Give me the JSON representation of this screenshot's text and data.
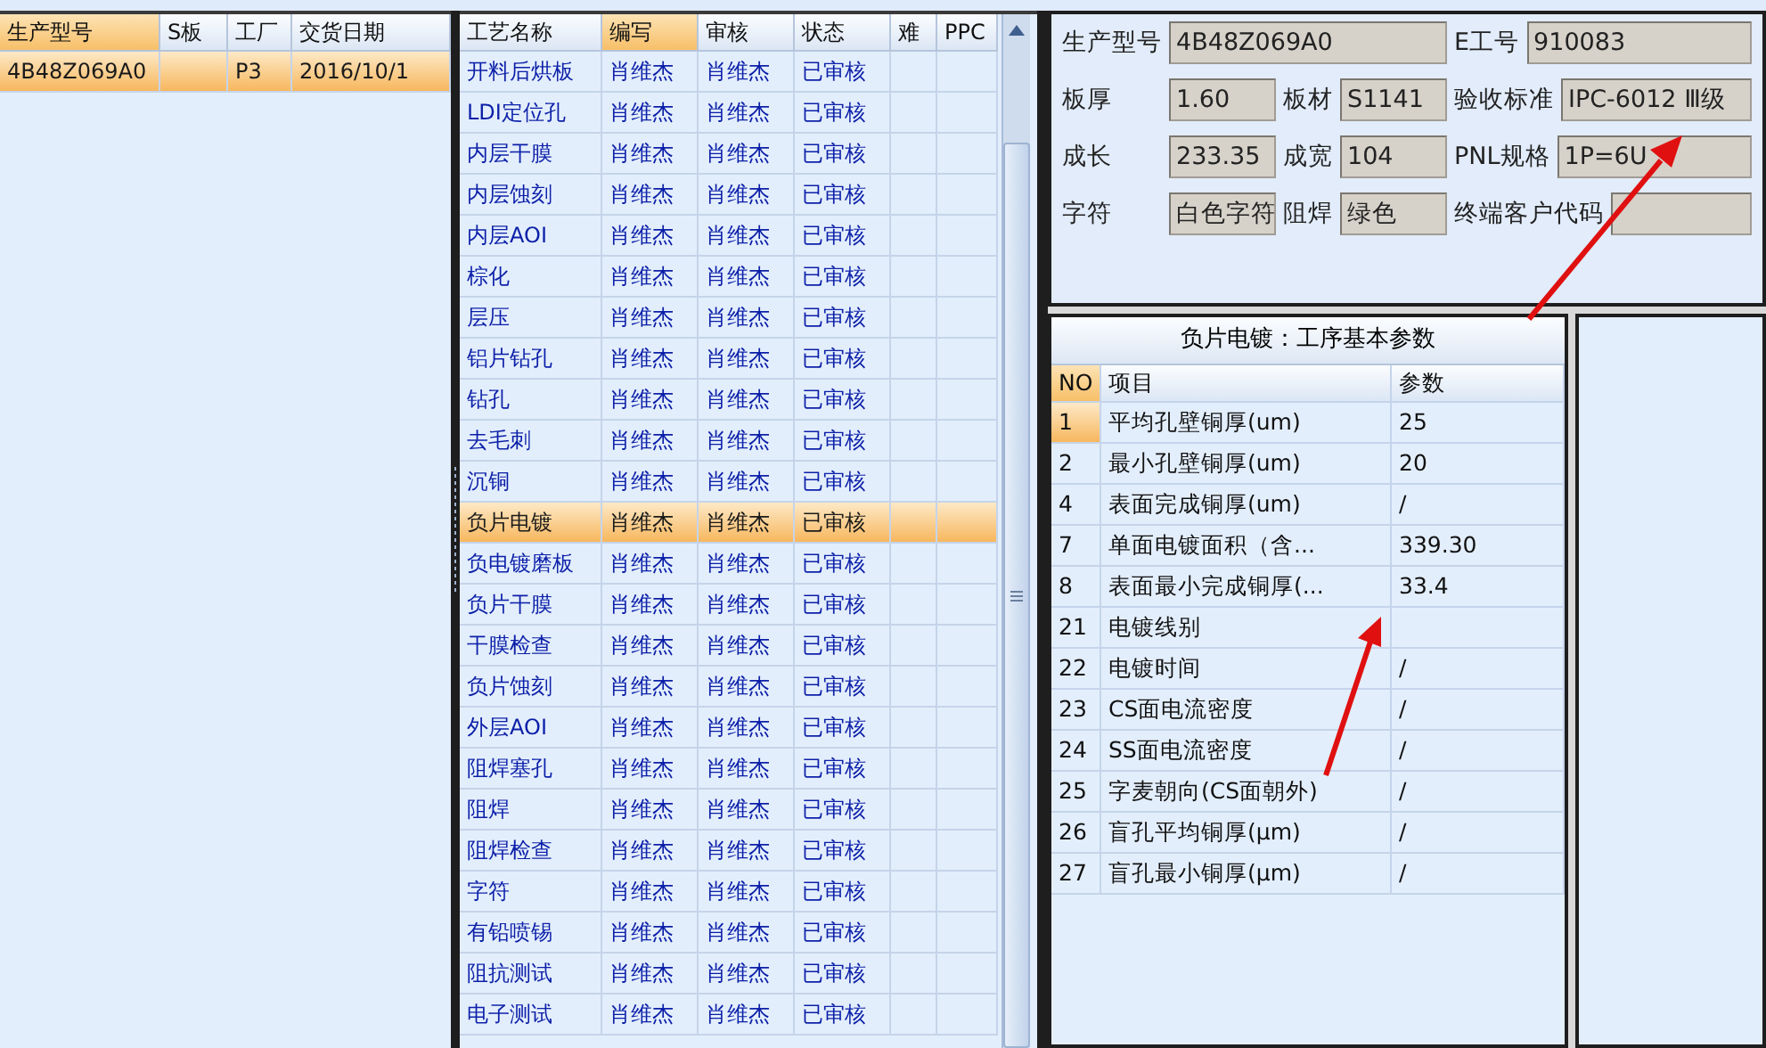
{
  "orders": {
    "columns": [
      {
        "label": "生产型号",
        "highlighted": true
      },
      {
        "label": "S板",
        "highlighted": false
      },
      {
        "label": "工厂",
        "highlighted": false
      },
      {
        "label": "交货日期",
        "highlighted": false
      }
    ],
    "rows": [
      {
        "model": "4B48Z069A0",
        "factory": "P3",
        "delivery_date": "2016/10/1",
        "selected": true
      }
    ]
  },
  "processes": {
    "columns": [
      {
        "label": "工艺名称",
        "highlighted": false
      },
      {
        "label": "编写",
        "highlighted": true
      },
      {
        "label": "审核",
        "highlighted": false
      },
      {
        "label": "状态",
        "highlighted": false
      },
      {
        "label": "难",
        "highlighted": false
      },
      {
        "label": "PPC",
        "highlighted": false
      }
    ],
    "rows": [
      {
        "name": "开料后烘板",
        "writer": "肖维杰",
        "reviewer": "肖维杰",
        "status": "已审核",
        "selected": false
      },
      {
        "name": "LDI定位孔",
        "writer": "肖维杰",
        "reviewer": "肖维杰",
        "status": "已审核",
        "selected": false
      },
      {
        "name": "内层干膜",
        "writer": "肖维杰",
        "reviewer": "肖维杰",
        "status": "已审核",
        "selected": false
      },
      {
        "name": "内层蚀刻",
        "writer": "肖维杰",
        "reviewer": "肖维杰",
        "status": "已审核",
        "selected": false
      },
      {
        "name": "内层AOI",
        "writer": "肖维杰",
        "reviewer": "肖维杰",
        "status": "已审核",
        "selected": false
      },
      {
        "name": "棕化",
        "writer": "肖维杰",
        "reviewer": "肖维杰",
        "status": "已审核",
        "selected": false
      },
      {
        "name": "层压",
        "writer": "肖维杰",
        "reviewer": "肖维杰",
        "status": "已审核",
        "selected": false
      },
      {
        "name": "铝片钻孔",
        "writer": "肖维杰",
        "reviewer": "肖维杰",
        "status": "已审核",
        "selected": false
      },
      {
        "name": "钻孔",
        "writer": "肖维杰",
        "reviewer": "肖维杰",
        "status": "已审核",
        "selected": false
      },
      {
        "name": "去毛刺",
        "writer": "肖维杰",
        "reviewer": "肖维杰",
        "status": "已审核",
        "selected": false
      },
      {
        "name": "沉铜",
        "writer": "肖维杰",
        "reviewer": "肖维杰",
        "status": "已审核",
        "selected": false
      },
      {
        "name": "负片电镀",
        "writer": "肖维杰",
        "reviewer": "肖维杰",
        "status": "已审核",
        "selected": true
      },
      {
        "name": "负电镀磨板",
        "writer": "肖维杰",
        "reviewer": "肖维杰",
        "status": "已审核",
        "selected": false
      },
      {
        "name": "负片干膜",
        "writer": "肖维杰",
        "reviewer": "肖维杰",
        "status": "已审核",
        "selected": false
      },
      {
        "name": "干膜检查",
        "writer": "肖维杰",
        "reviewer": "肖维杰",
        "status": "已审核",
        "selected": false
      },
      {
        "name": "负片蚀刻",
        "writer": "肖维杰",
        "reviewer": "肖维杰",
        "status": "已审核",
        "selected": false
      },
      {
        "name": "外层AOI",
        "writer": "肖维杰",
        "reviewer": "肖维杰",
        "status": "已审核",
        "selected": false
      },
      {
        "name": "阻焊塞孔",
        "writer": "肖维杰",
        "reviewer": "肖维杰",
        "status": "已审核",
        "selected": false
      },
      {
        "name": "阻焊",
        "writer": "肖维杰",
        "reviewer": "肖维杰",
        "status": "已审核",
        "selected": false
      },
      {
        "name": "阻焊检查",
        "writer": "肖维杰",
        "reviewer": "肖维杰",
        "status": "已审核",
        "selected": false
      },
      {
        "name": "字符",
        "writer": "肖维杰",
        "reviewer": "肖维杰",
        "status": "已审核",
        "selected": false
      },
      {
        "name": "有铅喷锡",
        "writer": "肖维杰",
        "reviewer": "肖维杰",
        "status": "已审核",
        "selected": false
      },
      {
        "name": "阻抗测试",
        "writer": "肖维杰",
        "reviewer": "肖维杰",
        "status": "已审核",
        "selected": false
      },
      {
        "name": "电子测试",
        "writer": "肖维杰",
        "reviewer": "肖维杰",
        "status": "已审核",
        "selected": false
      }
    ]
  },
  "details": {
    "fields": [
      {
        "label": "生产型号",
        "value": "4B48Z069A0"
      },
      {
        "label": "E工号",
        "value": "910083"
      },
      {
        "label": "板厚",
        "value": "1.60"
      },
      {
        "label": "板材",
        "value": "S1141"
      },
      {
        "label": "验收标准",
        "value": "IPC-6012 Ⅲ级"
      },
      {
        "label": "成长",
        "value": "233.35"
      },
      {
        "label": "成宽",
        "value": "104"
      },
      {
        "label": "PNL规格",
        "value": "1P=6U"
      },
      {
        "label": "字符",
        "value": "白色字符"
      },
      {
        "label": "阻焊",
        "value": "绿色"
      },
      {
        "label": "终端客户代码"
      }
    ]
  },
  "parameters": {
    "title": "负片电镀：工序基本参数",
    "columns": [
      {
        "label": "NO",
        "highlighted": true
      },
      {
        "label": "项目",
        "highlighted": false
      },
      {
        "label": "参数",
        "highlighted": false
      }
    ],
    "rows": [
      {
        "no": "1",
        "item": "平均孔壁铜厚(um)",
        "value": "25",
        "current": true
      },
      {
        "no": "2",
        "item": "最小孔壁铜厚(um)",
        "value": "20",
        "current": false
      },
      {
        "no": "4",
        "item": "表面完成铜厚(um)",
        "value": "/",
        "current": false
      },
      {
        "no": "7",
        "item": "单面电镀面积（含...",
        "value": "339.30",
        "current": false
      },
      {
        "no": "8",
        "item": "表面最小完成铜厚(...",
        "value": "33.4",
        "current": false
      },
      {
        "no": "21",
        "item": "电镀线别",
        "current": false
      },
      {
        "no": "22",
        "item": "电镀时间",
        "value": "/",
        "current": false
      },
      {
        "no": "23",
        "item": "CS面电流密度",
        "value": "/",
        "current": false
      },
      {
        "no": "24",
        "item": "SS面电流密度",
        "value": "/",
        "current": false
      },
      {
        "no": "25",
        "item": "字麦朝向(CS面朝外)",
        "value": "/",
        "current": false
      },
      {
        "no": "26",
        "item": "盲孔平均铜厚(μm)",
        "value": "/",
        "current": false
      },
      {
        "no": "27",
        "item": "盲孔最小铜厚(μm)",
        "value": "/",
        "current": false
      }
    ]
  }
}
